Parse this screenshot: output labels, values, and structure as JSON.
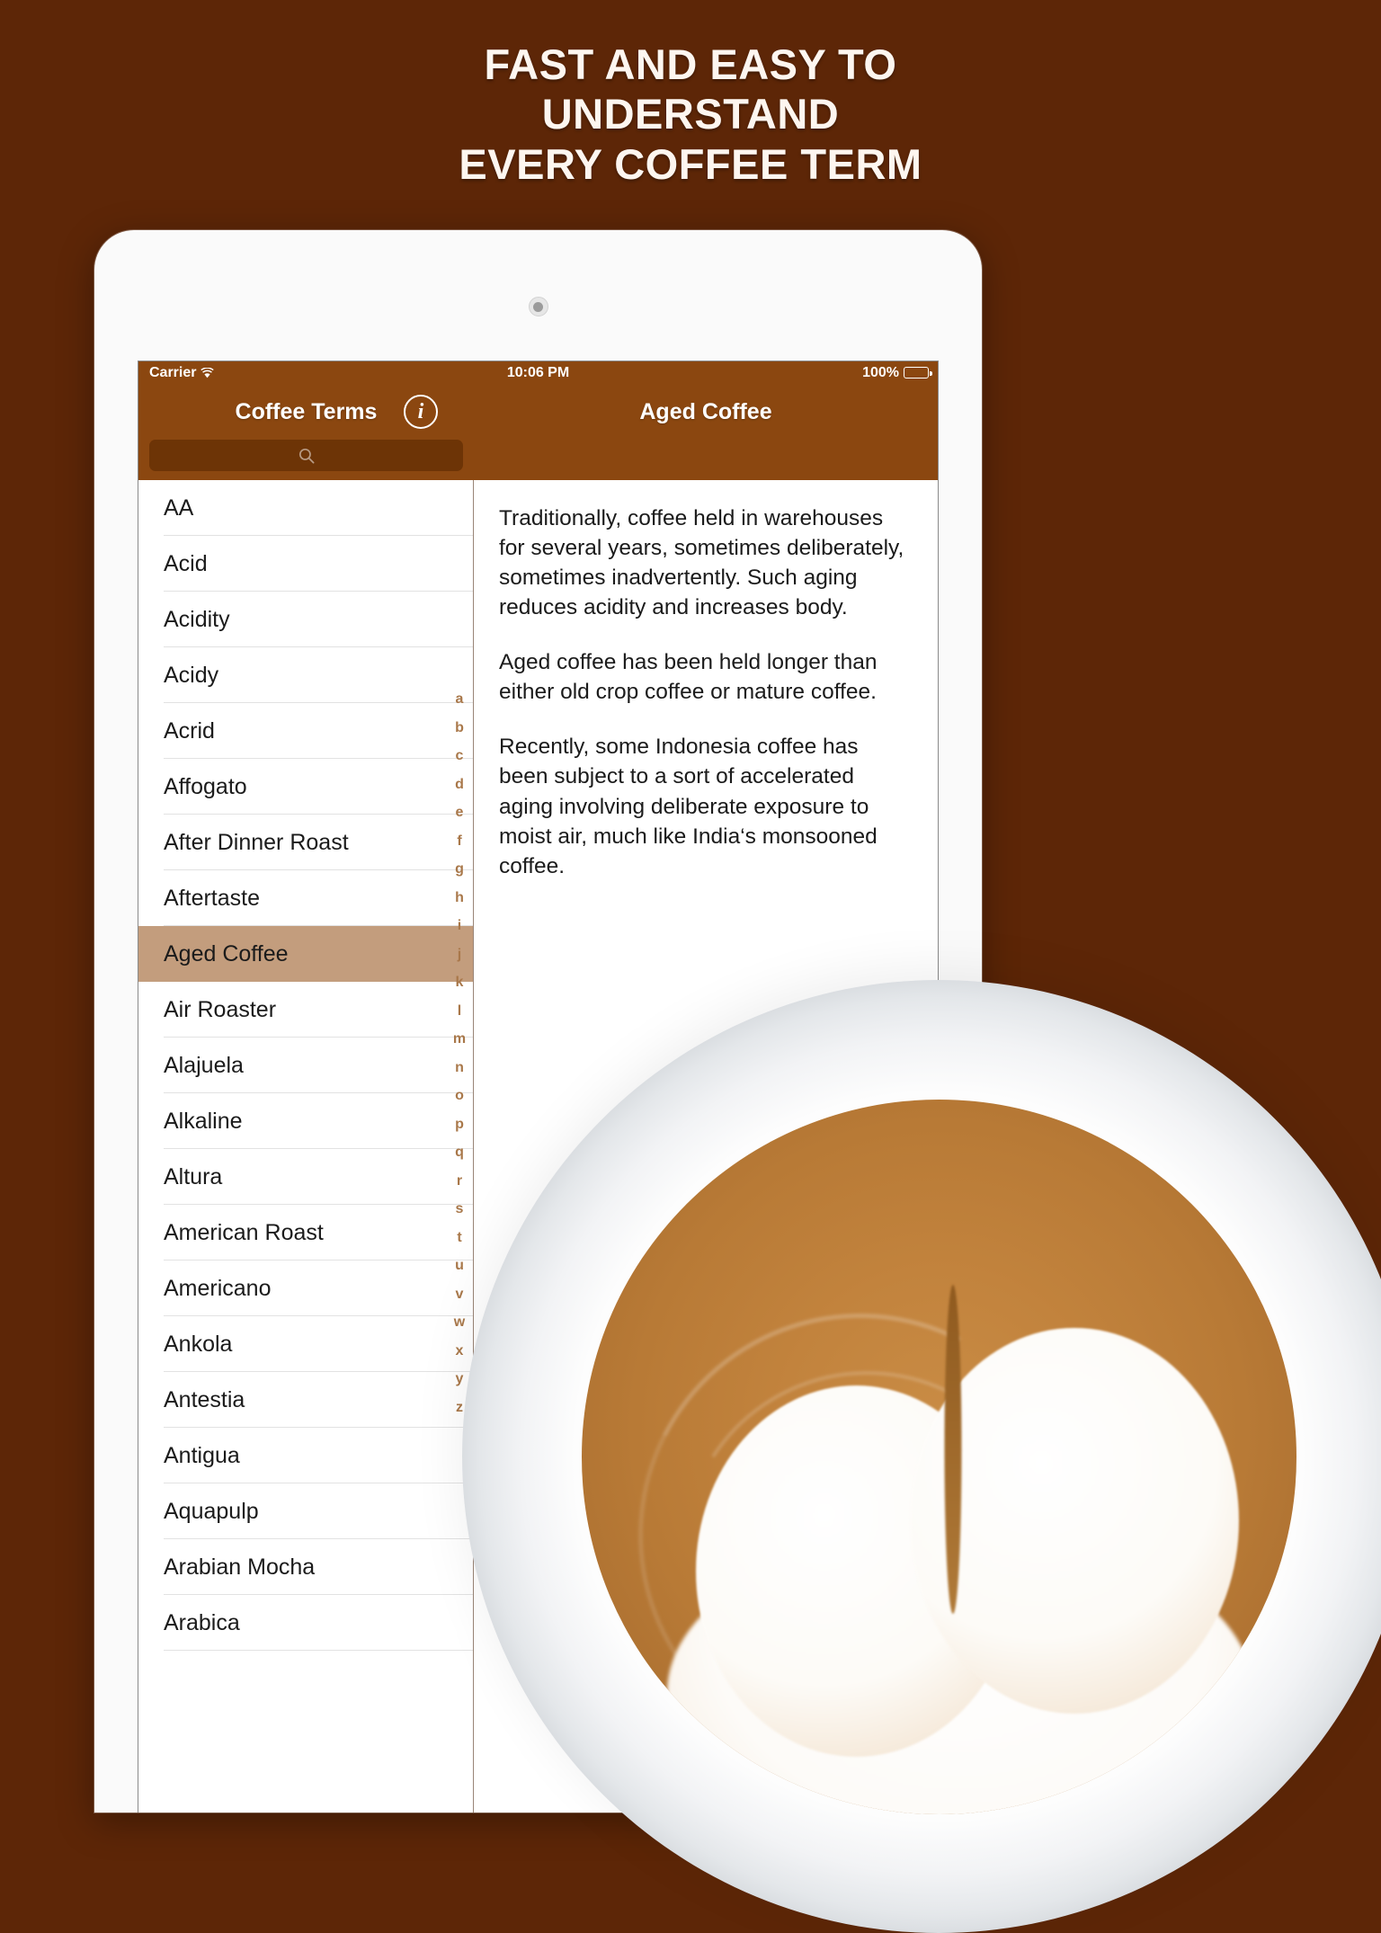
{
  "headline": {
    "line1": "FAST AND EASY TO",
    "line2": "UNDERSTAND",
    "line3": "EVERY COFFEE TERM"
  },
  "colors": {
    "background": "#5d2607",
    "nav_bar": "#8b4710",
    "search_field": "#6d3406",
    "selected_row": "#c39d7d",
    "index_letter": "#a9784a",
    "headline_text": "#fdf6f0"
  },
  "status_bar": {
    "carrier": "Carrier",
    "wifi_icon": "wifi-icon",
    "time": "10:06 PM",
    "battery_percent": "100%",
    "battery_icon": "battery-full-icon"
  },
  "nav": {
    "master_title": "Coffee Terms",
    "info_button_label": "i",
    "info_icon": "info-circle-icon",
    "detail_title": "Aged Coffee"
  },
  "search": {
    "value": "",
    "placeholder": "",
    "icon": "search-icon"
  },
  "list": {
    "selected": "Aged Coffee",
    "items": [
      "AA",
      "Acid",
      "Acidity",
      "Acidy",
      "Acrid",
      "Affogato",
      "After Dinner Roast",
      "Aftertaste",
      "Aged Coffee",
      "Air Roaster",
      "Alajuela",
      "Alkaline",
      "Altura",
      "American Roast",
      "Americano",
      "Ankola",
      "Antestia",
      "Antigua",
      "Aquapulp",
      "Arabian Mocha",
      "Arabica"
    ]
  },
  "index_strip": {
    "letters": [
      "a",
      "b",
      "c",
      "d",
      "e",
      "f",
      "g",
      "h",
      "i",
      "j",
      "k",
      "l",
      "m",
      "n",
      "o",
      "p",
      "q",
      "r",
      "s",
      "t",
      "u",
      "v",
      "w",
      "x",
      "y",
      "z"
    ]
  },
  "detail": {
    "paragraphs": [
      "Traditionally, coffee held in warehouses for several years, sometimes deliberately, sometimes inadvertently. Such aging reduces acidity and increases body.",
      "Aged coffee has been held longer than either old crop coffee or mature coffee.",
      "Recently, some Indonesia coffee has been subject to a sort of accelerated aging involving deliberate exposure to moist air, much like India‘s monsooned coffee."
    ]
  },
  "photo": {
    "description": "latte-art-coffee-cup"
  }
}
